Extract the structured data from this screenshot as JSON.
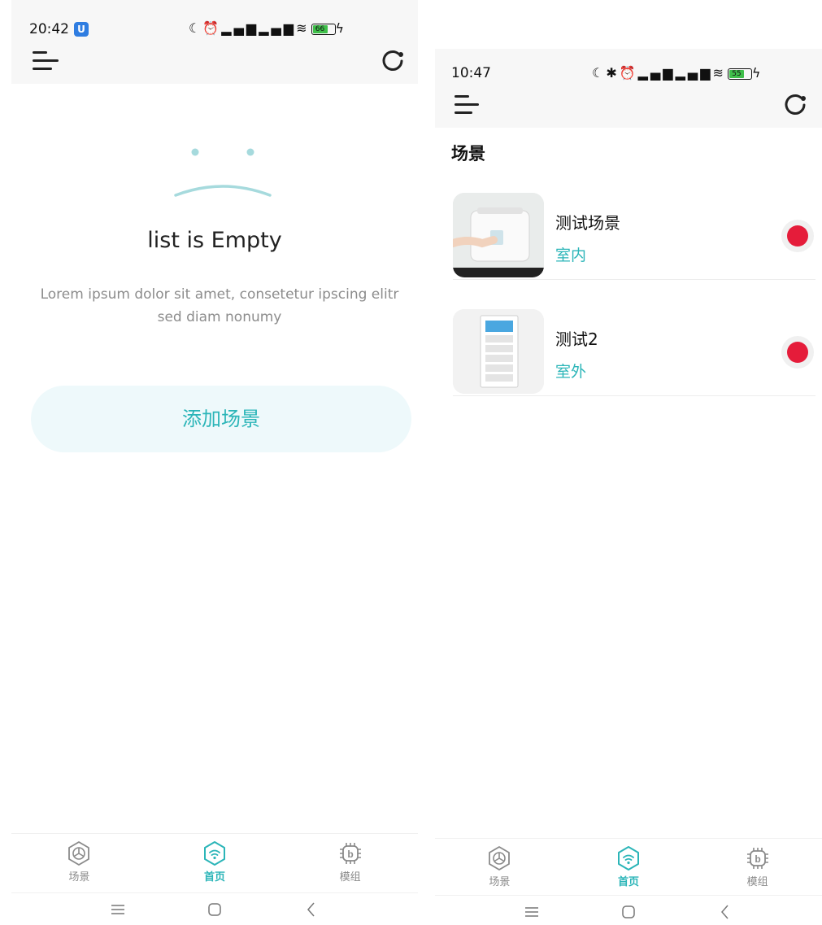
{
  "left": {
    "status": {
      "time": "20:42",
      "notif_badge": "U",
      "battery": "66"
    },
    "empty": {
      "title": "list is Empty",
      "description": "Lorem ipsum dolor sit amet, consetetur ipscing elitr sed diam nonumy",
      "add_button": "添加场景"
    },
    "nav": {
      "scene": "场景",
      "home": "首页",
      "module": "模组"
    }
  },
  "right": {
    "status": {
      "time": "10:47",
      "battery": "55"
    },
    "section_title": "场景",
    "items": [
      {
        "name": "测试场景",
        "type": "室内",
        "status_color": "#e51c3a"
      },
      {
        "name": "测试2",
        "type": "室外",
        "status_color": "#e51c3a"
      }
    ],
    "nav": {
      "scene": "场景",
      "home": "首页",
      "module": "模组"
    }
  },
  "colors": {
    "accent": "#2bb5b8",
    "status_red": "#e51c3a",
    "button_bg": "#eef9fb"
  },
  "icons": [
    "menu-icon",
    "refresh-icon",
    "moon-icon",
    "alarm-icon",
    "signal-icon",
    "wifi-icon",
    "battery-icon",
    "bluetooth-icon",
    "scene-icon",
    "home-wifi-icon",
    "chip-icon"
  ]
}
